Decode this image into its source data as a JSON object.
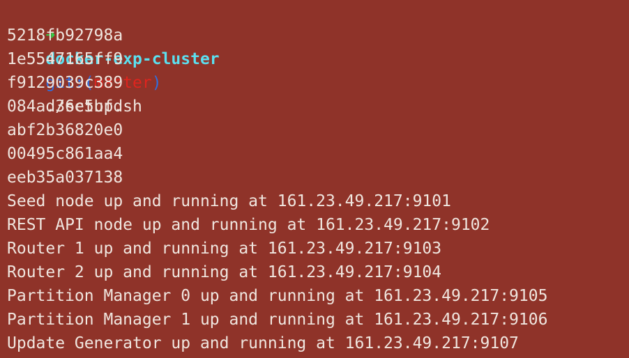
{
  "prompt": {
    "arrow": "➜",
    "directory": "docker-exp-cluster",
    "git_prefix": "git:(",
    "branch": "master",
    "git_suffix": ")",
    "command": "./setup.sh"
  },
  "output_lines": [
    "5218fb92798a",
    "1e5547165ff9",
    "f9129039c389",
    "084ad36c5bfd",
    "abf2b36820e0",
    "00495c861aa4",
    "eeb35a037138",
    "Seed node up and running at 161.23.49.217:9101",
    "REST API node up and running at 161.23.49.217:9102",
    "Router 1 up and running at 161.23.49.217:9103",
    "Router 2 up and running at 161.23.49.217:9104",
    "Partition Manager 0 up and running at 161.23.49.217:9105",
    "Partition Manager 1 up and running at 161.23.49.217:9106",
    "Update Generator up and running at 161.23.49.217:9107"
  ],
  "colors": {
    "background": "#8f3329",
    "text": "#f0e6df",
    "arrow": "#2fd047",
    "directory": "#5be0f0",
    "git": "#2f6fe0",
    "branch": "#e0241e"
  }
}
